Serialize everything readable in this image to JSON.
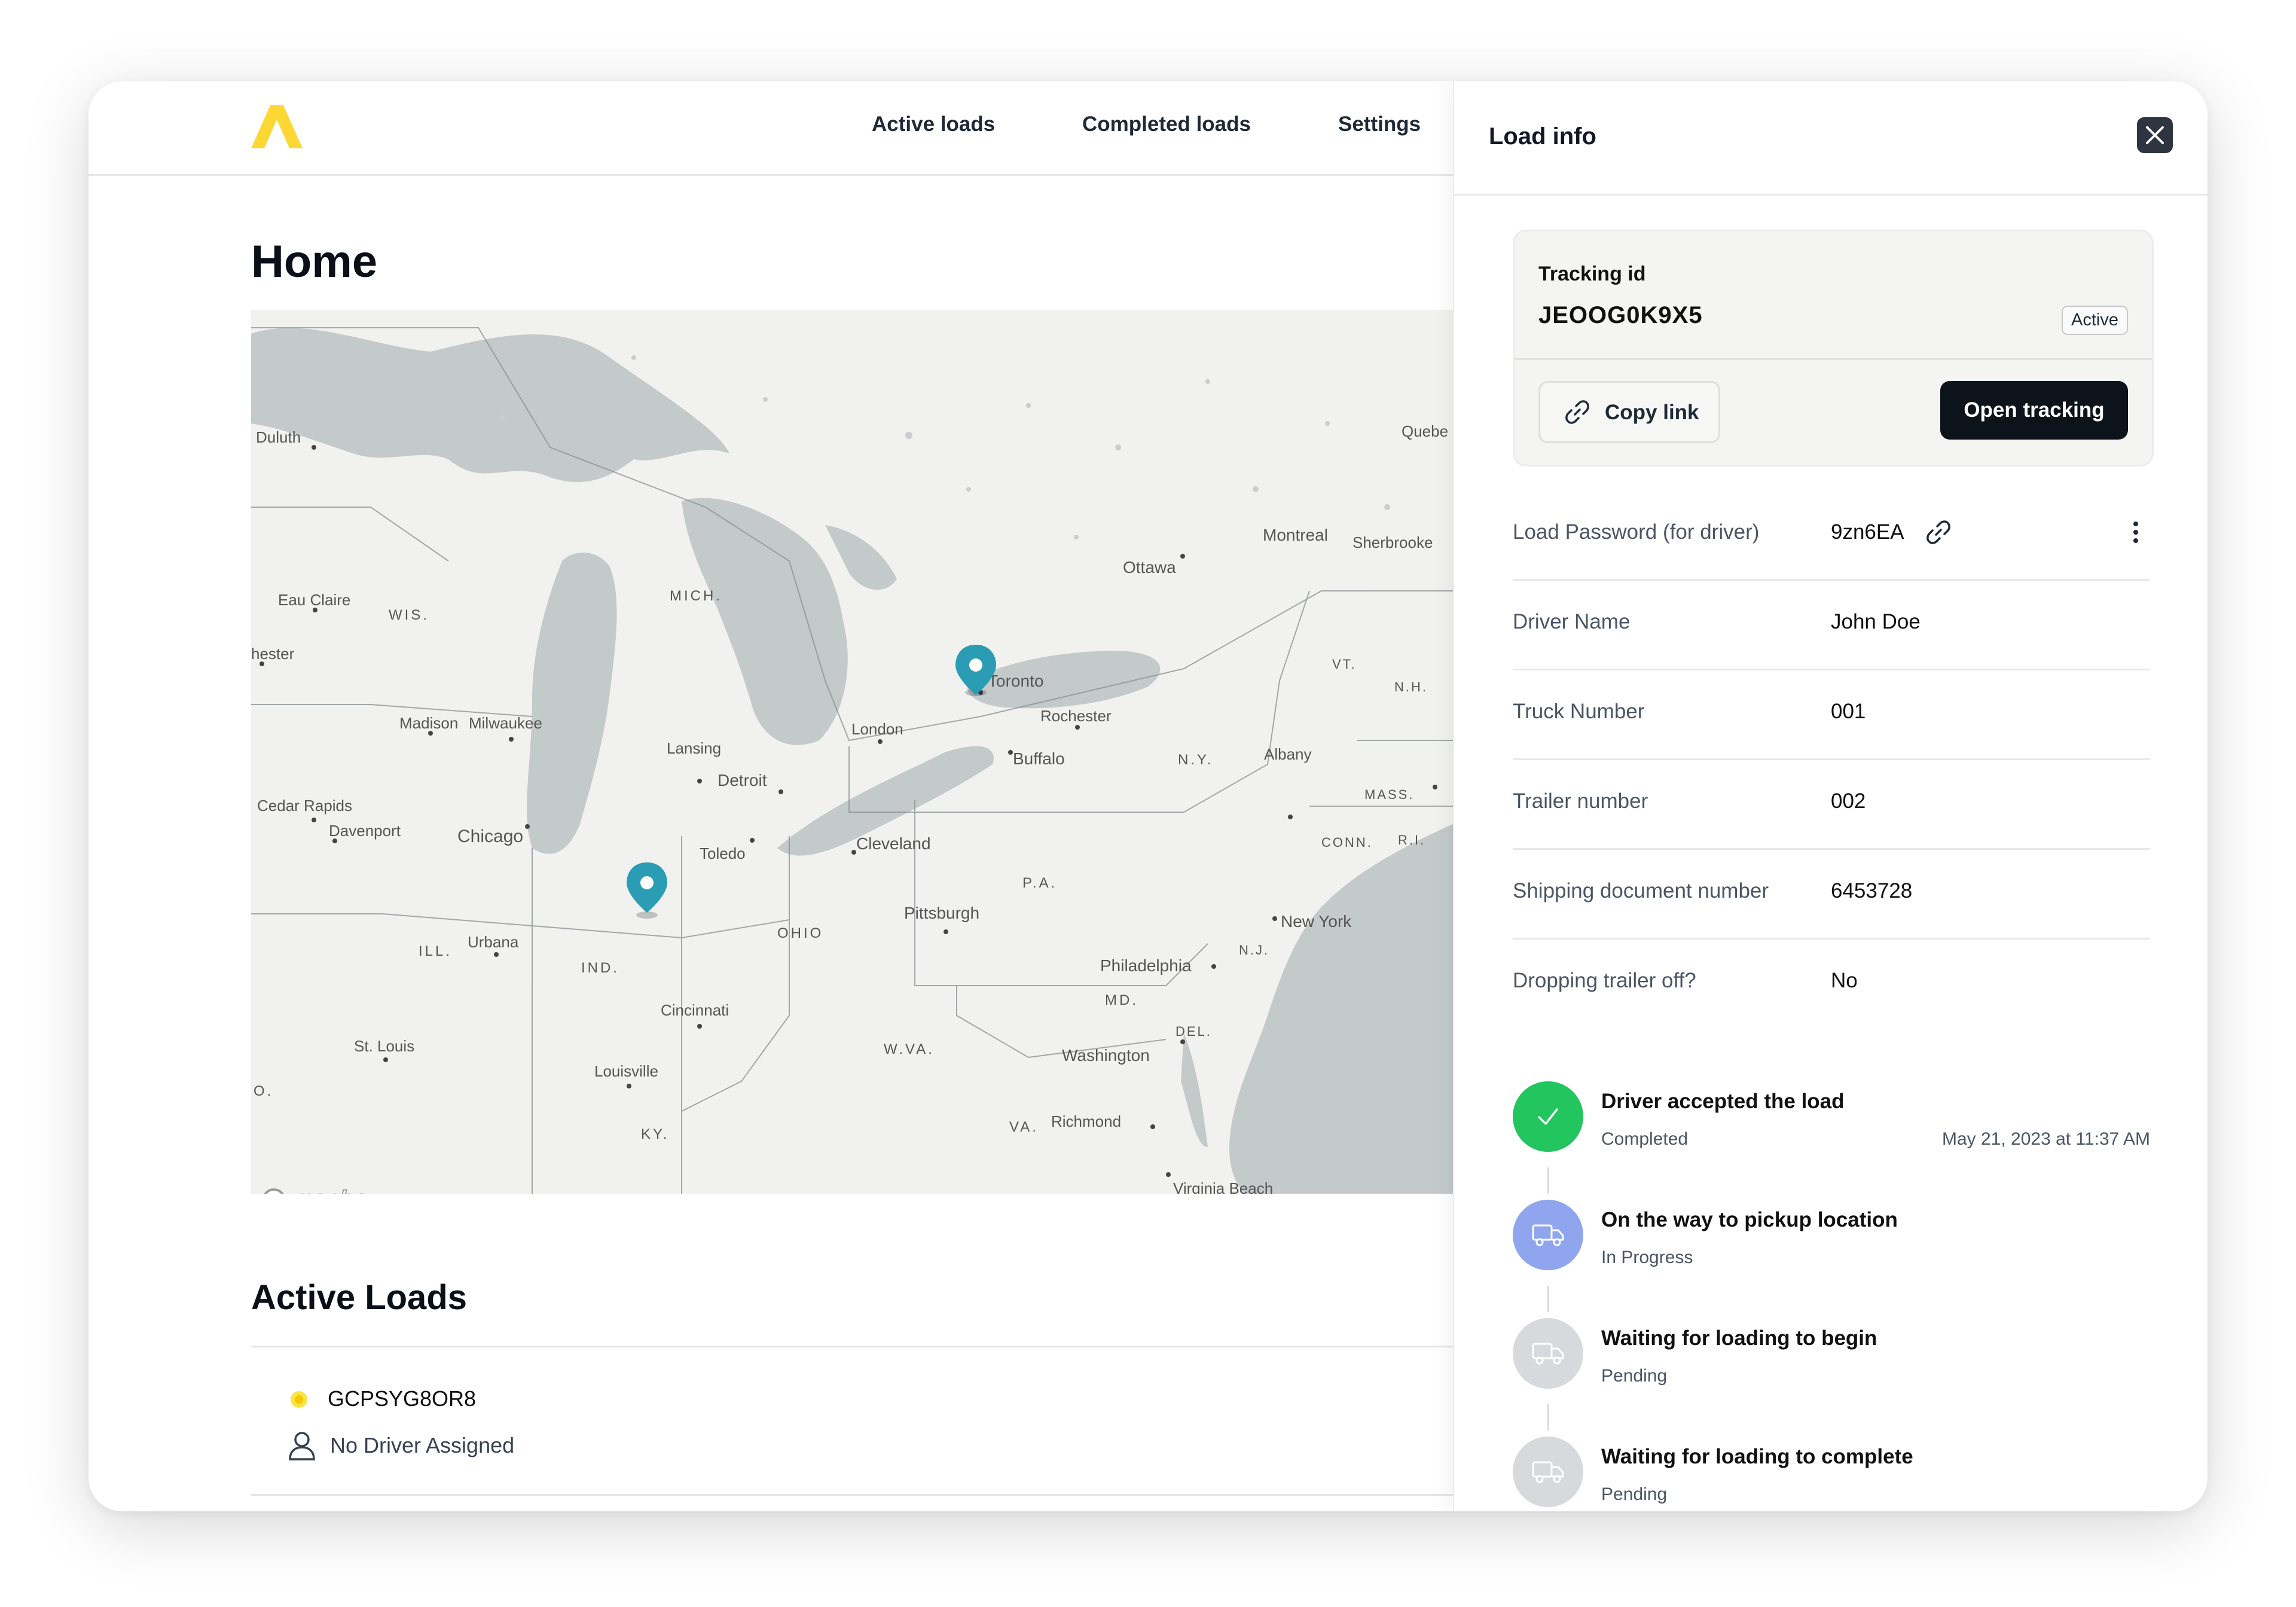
{
  "nav": {
    "items": [
      {
        "label": "Active loads"
      },
      {
        "label": "Completed loads"
      },
      {
        "label": "Settings"
      }
    ]
  },
  "page": {
    "title": "Home"
  },
  "map": {
    "attribution": "mapbox",
    "labels": [
      "Duluth",
      "Eau Claire",
      "WIS.",
      "hester",
      "MICH.",
      "Madison",
      "Milwaukee",
      "Lansing",
      "Detroit",
      "Chicago",
      "Cedar Rapids",
      "Davenport",
      "Toledo",
      "ILL.",
      "Urbana",
      "IND.",
      "OHIO",
      "Cleveland",
      "Pittsburgh",
      "P.A.",
      "Cincinnati",
      "St. Louis",
      "Louisville",
      "KY.",
      "W.VA.",
      "Washington",
      "Richmond",
      "VA.",
      "MD.",
      "DEL.",
      "Philadelphia",
      "N.J.",
      "New York",
      "CONN.",
      "R.I.",
      "MASS.",
      "N.Y.",
      "Albany",
      "Buffalo",
      "Rochester",
      "Toronto",
      "London",
      "Ottawa",
      "Montreal",
      "Sherbrooke",
      "Quebe",
      "VT.",
      "N.H.",
      "O.",
      "Virginia Beach"
    ],
    "pin_color": "#2a9db5"
  },
  "active_loads": {
    "title": "Active Loads",
    "items": [
      {
        "id": "GCPSYG8OR8",
        "driver": "No Driver Assigned",
        "status_color": "#f5c800"
      }
    ]
  },
  "panel": {
    "title": "Load info",
    "tracking": {
      "label": "Tracking id",
      "id": "JEOOG0K9X5",
      "status": "Active",
      "copy_label": "Copy link",
      "open_label": "Open tracking"
    },
    "fields": [
      {
        "label": "Load Password (for driver)",
        "value": "9zn6EA"
      },
      {
        "label": "Driver Name",
        "value": "John Doe"
      },
      {
        "label": "Truck Number",
        "value": "001"
      },
      {
        "label": "Trailer number",
        "value": "002"
      },
      {
        "label": "Shipping document number",
        "value": "6453728"
      },
      {
        "label": "Dropping trailer off?",
        "value": "No"
      }
    ],
    "steps": [
      {
        "title": "Driver accepted the load",
        "status": "Completed",
        "time": "May 21, 2023 at 11:37 AM",
        "color": "#22c55e",
        "icon": "check-icon"
      },
      {
        "title": "On the way to pickup location",
        "status": "In Progress",
        "color": "#8fa6ee",
        "icon": "truck-icon"
      },
      {
        "title": "Waiting for loading to begin",
        "status": "Pending",
        "color": "#d7d9dc",
        "icon": "truck-icon"
      },
      {
        "title": "Waiting for loading to complete",
        "status": "Pending",
        "color": "#d7d9dc",
        "icon": "truck-icon"
      }
    ]
  },
  "colors": {
    "brand": "#fdd835",
    "primary_button": "#0d131b"
  }
}
